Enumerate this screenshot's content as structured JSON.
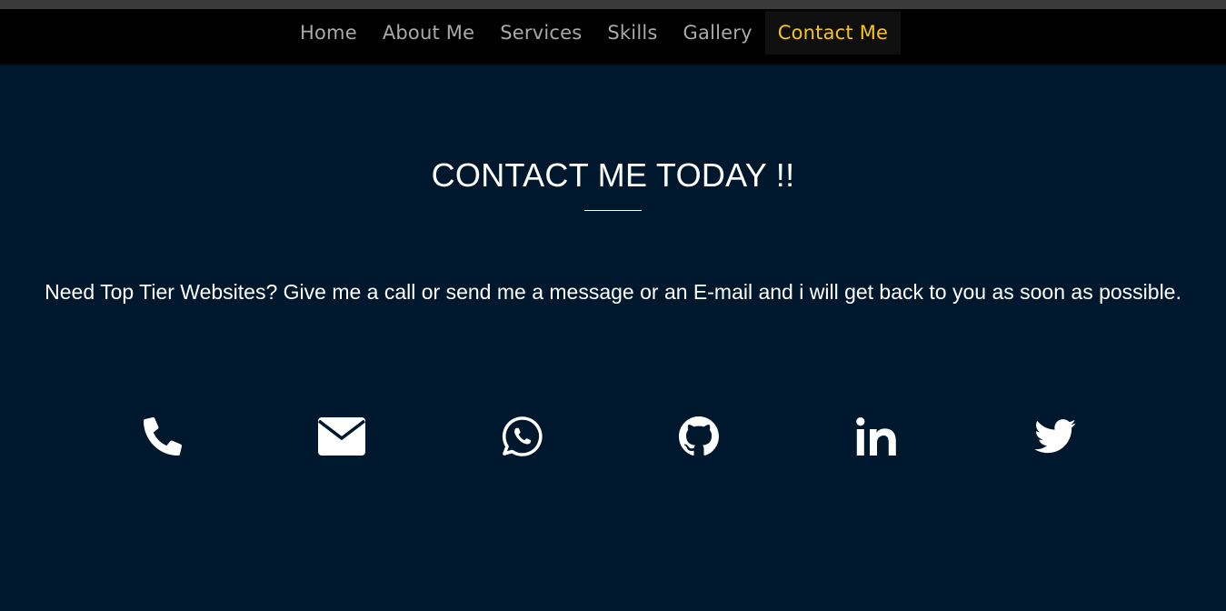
{
  "nav": {
    "items": [
      {
        "label": "Home",
        "active": false
      },
      {
        "label": "About Me",
        "active": false
      },
      {
        "label": "Services",
        "active": false
      },
      {
        "label": "Skills",
        "active": false
      },
      {
        "label": "Gallery",
        "active": false
      },
      {
        "label": "Contact Me",
        "active": true
      }
    ]
  },
  "contact": {
    "title": "CONTACT ME TODAY !!",
    "text": "Need Top Tier Websites? Give me a call or send me a message or an E-mail and i will get back to you as soon as possible.",
    "icons": [
      "phone-icon",
      "envelope-icon",
      "whatsapp-icon",
      "github-icon",
      "linkedin-icon",
      "twitter-icon"
    ]
  },
  "colors": {
    "background": "#00182d",
    "navbar": "#000000",
    "nav_text": "#a9a9a9",
    "nav_active": "#f6c51a",
    "text": "#ffffff"
  }
}
